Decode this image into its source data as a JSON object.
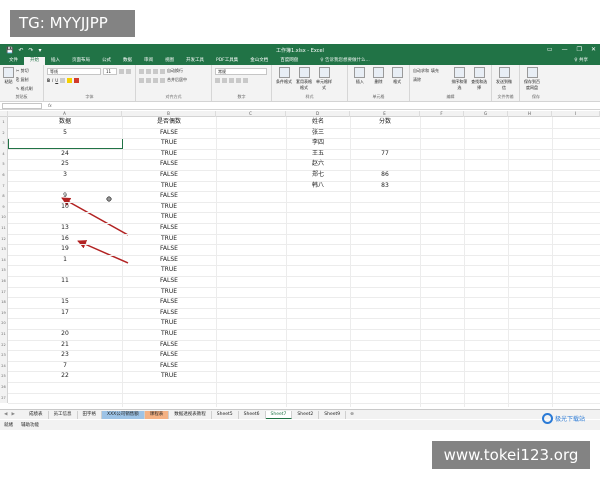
{
  "overlay": {
    "top_left": "TG: MYYJJPP",
    "bottom_right": "www.tokei123.org"
  },
  "window": {
    "title": "工作簿1.xlsx - Excel",
    "quick_access": [
      "💾",
      "↶",
      "↷",
      "▾"
    ],
    "controls": [
      "▭",
      "—",
      "❐",
      "✕"
    ]
  },
  "tabs": [
    "文件",
    "开始",
    "插入",
    "页面布局",
    "公式",
    "数据",
    "审阅",
    "视图",
    "开发工具",
    "PDF工具集",
    "金山文档",
    "百度网盘"
  ],
  "active_tab": "开始",
  "tell_me": "♀ 告诉我您想要做什么...",
  "share": "♀ 共享",
  "ribbon": {
    "clipboard": {
      "cut": "✂ 剪切",
      "copy": "⎘ 复制",
      "painter": "✎ 格式刷",
      "paste": "粘贴",
      "label": "剪贴板"
    },
    "font": {
      "name": "等线",
      "size": "11",
      "label": "字体",
      "bold": "B",
      "italic": "I",
      "underline": "U"
    },
    "alignment": {
      "wrap": "自动换行",
      "merge": "合并后居中",
      "label": "对齐方式"
    },
    "number": {
      "format": "常规",
      "label": "数字"
    },
    "styles": {
      "conditional": "条件格式",
      "table": "套用表格格式",
      "cell": "单元格样式",
      "label": "样式"
    },
    "cells": {
      "insert": "插入",
      "delete": "删除",
      "format": "格式",
      "label": "单元格"
    },
    "editing": {
      "autosum": "自动求和",
      "fill": "填充",
      "clear": "清除",
      "sort": "排序和筛选",
      "find": "查找和选择",
      "label": "编辑"
    },
    "share_group": {
      "send": "发送到微信",
      "label": "文件传输"
    },
    "baidu": {
      "save": "保存到百度网盘",
      "label": "保存"
    }
  },
  "columns": [
    "A",
    "B",
    "C",
    "D",
    "E",
    "F",
    "G",
    "H",
    "I"
  ],
  "headers": {
    "data": "数据",
    "even": "是否偶数",
    "name": "姓名",
    "score": "分数"
  },
  "rows": [
    {
      "a": "5",
      "b": "FALSE",
      "d": "张三",
      "e": ""
    },
    {
      "a": "",
      "b": "TRUE",
      "d": "李四",
      "e": ""
    },
    {
      "a": "24",
      "b": "TRUE",
      "d": "王五",
      "e": "77"
    },
    {
      "a": "25",
      "b": "FALSE",
      "d": "赵六",
      "e": ""
    },
    {
      "a": "3",
      "b": "FALSE",
      "d": "郑七",
      "e": "86"
    },
    {
      "a": "",
      "b": "TRUE",
      "d": "韩八",
      "e": "83"
    },
    {
      "a": "9",
      "b": "FALSE",
      "d": "",
      "e": ""
    },
    {
      "a": "10",
      "b": "TRUE",
      "d": "",
      "e": ""
    },
    {
      "a": "",
      "b": "TRUE",
      "d": "",
      "e": ""
    },
    {
      "a": "13",
      "b": "FALSE",
      "d": "",
      "e": ""
    },
    {
      "a": "16",
      "b": "TRUE",
      "d": "",
      "e": ""
    },
    {
      "a": "19",
      "b": "FALSE",
      "d": "",
      "e": ""
    },
    {
      "a": "1",
      "b": "FALSE",
      "d": "",
      "e": ""
    },
    {
      "a": "",
      "b": "TRUE",
      "d": "",
      "e": ""
    },
    {
      "a": "11",
      "b": "FALSE",
      "d": "",
      "e": ""
    },
    {
      "a": "",
      "b": "TRUE",
      "d": "",
      "e": ""
    },
    {
      "a": "15",
      "b": "FALSE",
      "d": "",
      "e": ""
    },
    {
      "a": "17",
      "b": "FALSE",
      "d": "",
      "e": ""
    },
    {
      "a": "",
      "b": "TRUE",
      "d": "",
      "e": ""
    },
    {
      "a": "20",
      "b": "TRUE",
      "d": "",
      "e": ""
    },
    {
      "a": "21",
      "b": "FALSE",
      "d": "",
      "e": ""
    },
    {
      "a": "23",
      "b": "FALSE",
      "d": "",
      "e": ""
    },
    {
      "a": "7",
      "b": "FALSE",
      "d": "",
      "e": ""
    },
    {
      "a": "22",
      "b": "TRUE",
      "d": "",
      "e": ""
    }
  ],
  "sheets": [
    {
      "label": "成绩表",
      "color": ""
    },
    {
      "label": "员工信息",
      "color": ""
    },
    {
      "label": "田字格",
      "color": ""
    },
    {
      "label": "XXX公司销售额",
      "color": "#9dc3e6"
    },
    {
      "label": "课程表",
      "color": "#f4b183"
    },
    {
      "label": "数据透视表教程",
      "color": ""
    },
    {
      "label": "Sheet5",
      "color": ""
    },
    {
      "label": "Sheet6",
      "color": ""
    },
    {
      "label": "Sheet7",
      "color": "",
      "active": true
    },
    {
      "label": "Sheet2",
      "color": ""
    },
    {
      "label": "Sheet9",
      "color": ""
    }
  ],
  "sheet_add": "⊕",
  "status": {
    "mode": "就绪",
    "accessibility": "辅助功能"
  },
  "logo_text": "极光下载站",
  "accent": "#217346"
}
